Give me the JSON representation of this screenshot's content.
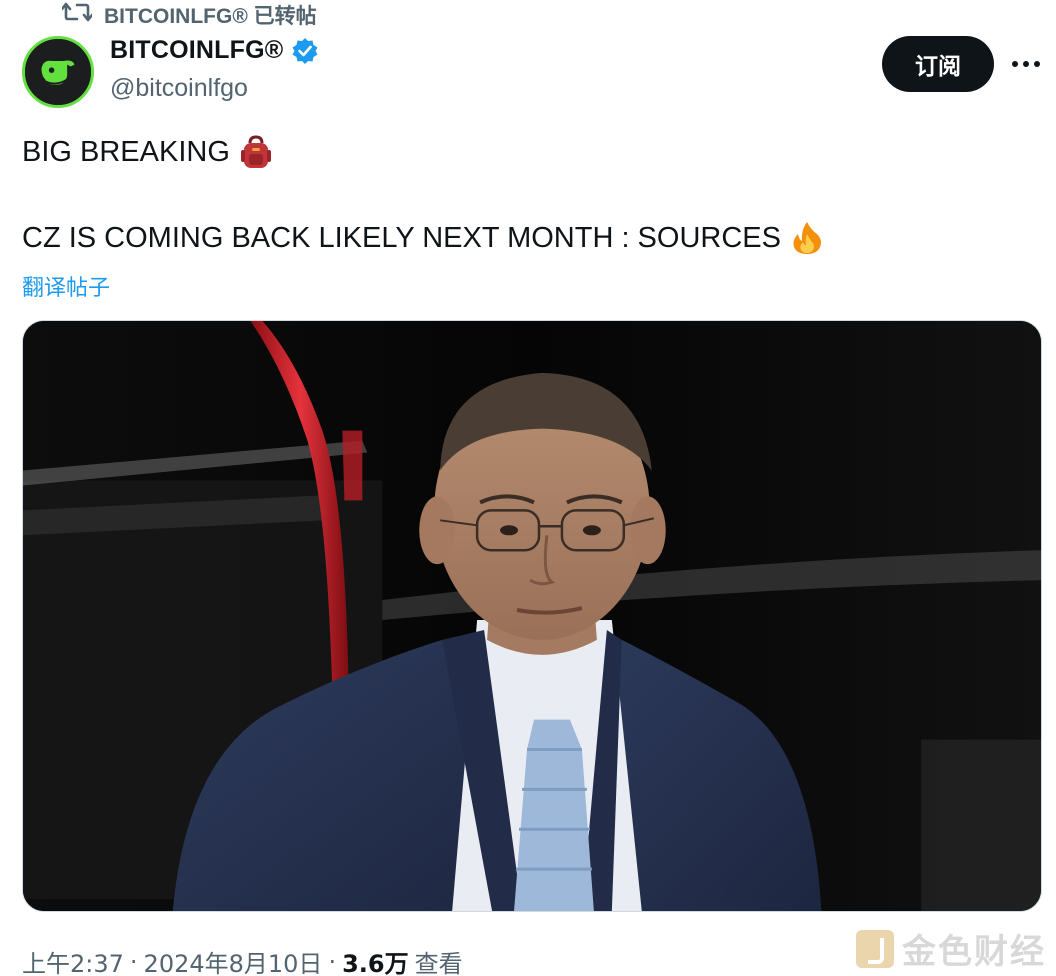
{
  "repost": {
    "icon": "repost-icon",
    "text": "BITCOINLFG® 已转帖"
  },
  "author": {
    "display_name": "BITCOINLFG®",
    "handle": "@bitcoinlfgo",
    "verified": true,
    "avatar_icon": "whale-logo-icon",
    "avatar_border_color": "#62e03d"
  },
  "actions": {
    "subscribe_label": "订阅",
    "more_icon": "more-options-icon"
  },
  "tweet": {
    "line1": "BIG BREAKING",
    "line1_emoji": "backpack-emoji",
    "line2": "CZ IS COMING BACK LIKELY NEXT MONTH : SOURCES",
    "line2_emoji": "fire-emoji",
    "translate_label": "翻译帖子"
  },
  "media": {
    "type": "photo"
  },
  "meta": {
    "time": "上午2:37",
    "separator": "·",
    "date": "2024年8月10日",
    "views_count": "3.6万",
    "views_label": "查看"
  },
  "watermark": {
    "text": "金色财经"
  },
  "colors": {
    "link": "#1d9bf0",
    "secondary_text": "#536471",
    "primary_text": "#0f1419",
    "button_bg": "#0f1419",
    "verified_badge": "#1d9bf0"
  }
}
